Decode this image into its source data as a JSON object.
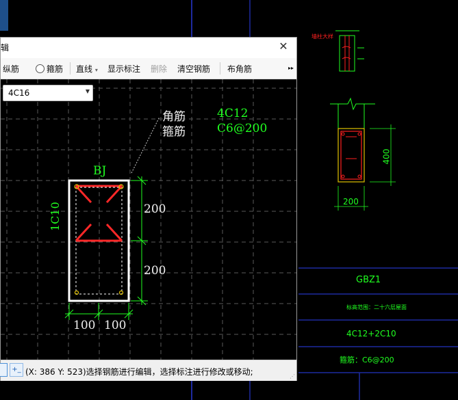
{
  "dialog": {
    "title": "辑",
    "toolbar": {
      "longitudinal": "纵筋",
      "stirrup": "箍筋",
      "line_mode": "直线",
      "line_mode_arrow": "▾",
      "show_labels": "显示标注",
      "delete": "删除",
      "clear_rebar": "清空钢筋",
      "corner_rebar": "布角筋",
      "more": "▸▸"
    },
    "combo_value": "4C16",
    "canvas": {
      "label_corner": "角筋",
      "label_stirrup": "箍筋",
      "corner_value": "4C12",
      "stirrup_value": "C6@200",
      "section_name": "BJ",
      "side_label": "1C10",
      "dim_upper": "200",
      "dim_lower": "200",
      "dim_left": "100",
      "dim_right": "100"
    },
    "status_text": "(X: 386 Y: 523)选择钢筋进行编辑，选择标注进行修改或移动;"
  },
  "background": {
    "top_label": "墙柱大样",
    "dim_right": "400",
    "dim_bottom": "200",
    "table_name": "GBZ1",
    "table_row2": "标高范围：二十六层屋面",
    "table_row3": "4C12+2C10",
    "table_row4": "箍筋：C6@200"
  },
  "colors": {
    "cad_green": "#20ff20",
    "cad_red": "#ff2020",
    "cad_yellow": "#e0c000"
  }
}
